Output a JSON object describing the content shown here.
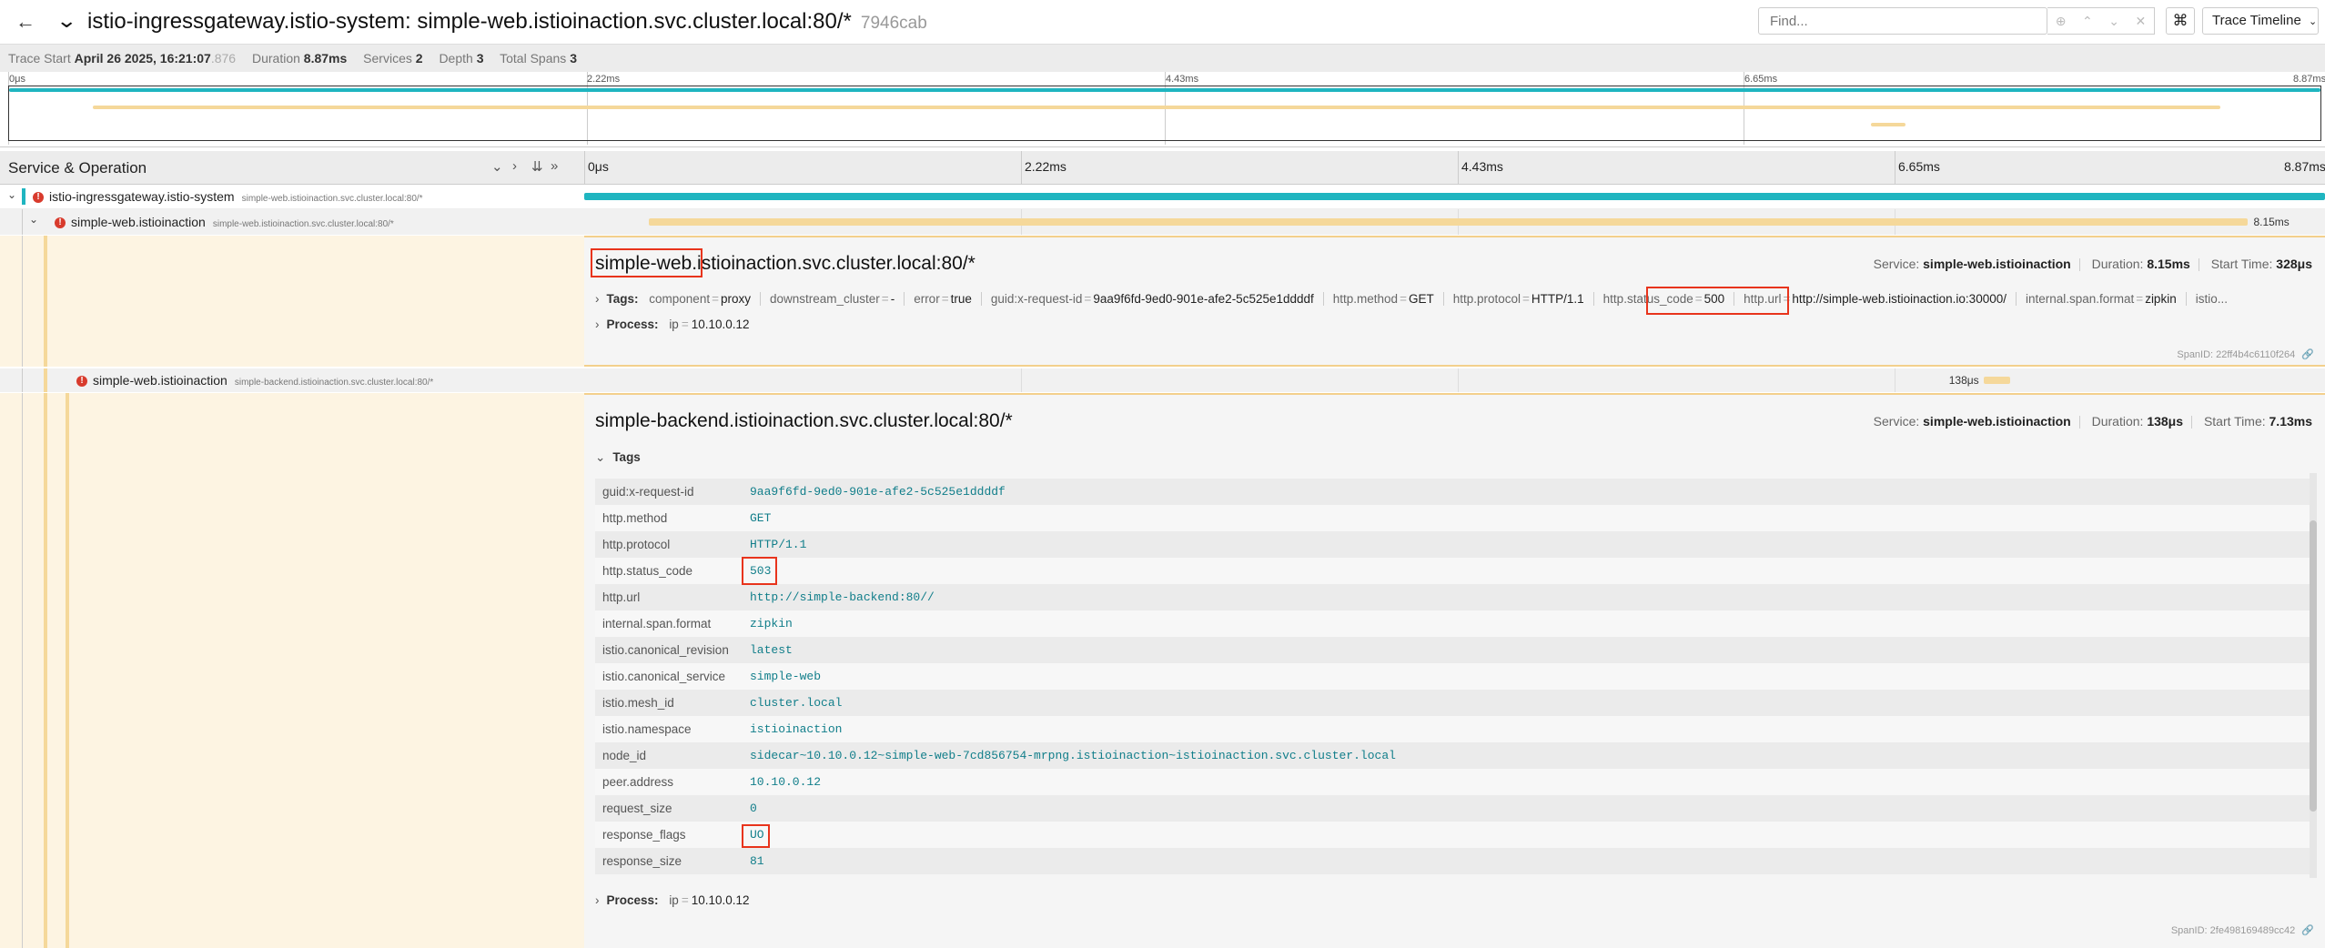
{
  "header": {
    "title": "istio-ingressgateway.istio-system: simple-web.istioinaction.svc.cluster.local:80/*",
    "trace_id": "7946cab",
    "find_placeholder": "Find...",
    "cmd_icon": "⌘",
    "view_select": "Trace Timeline"
  },
  "summary": {
    "trace_start_label": "Trace Start",
    "trace_start": "April 26 2025, 16:21:07",
    "trace_start_ms": ".876",
    "duration_label": "Duration",
    "duration": "8.87ms",
    "services_label": "Services",
    "services": "2",
    "depth_label": "Depth",
    "depth": "3",
    "total_spans_label": "Total Spans",
    "total_spans": "3"
  },
  "ticks": [
    "0μs",
    "2.22ms",
    "4.43ms",
    "6.65ms",
    "8.87ms"
  ],
  "table": {
    "service_operation_label": "Service & Operation"
  },
  "spans": [
    {
      "service": "istio-ingressgateway.istio-system",
      "operation": "simple-web.istioinaction.svc.cluster.local:80/*",
      "start_ms": 0,
      "duration_ms": 8.87,
      "color": "#1fb5c0"
    },
    {
      "service": "simple-web.istioinaction",
      "operation": "simple-web.istioinaction.svc.cluster.local:80/*",
      "start_ms": 0.328,
      "duration_ms": 8.15,
      "color": "#f5d89a",
      "bar_label": "8.15ms"
    },
    {
      "service": "simple-web.istioinaction",
      "operation": "simple-backend.istioinaction.svc.cluster.local:80/*",
      "start_ms": 7.13,
      "duration_ms": 0.138,
      "color": "#f5d89a",
      "bar_label": "138μs"
    }
  ],
  "detail1": {
    "title": "simple-web.istioinaction.svc.cluster.local:80/*",
    "service_label": "Service:",
    "service": "simple-web.istioinaction",
    "duration_label": "Duration:",
    "duration": "8.15ms",
    "start_label": "Start Time:",
    "start": "328μs",
    "tags_label": "Tags:",
    "tags": [
      {
        "k": "component",
        "v": "proxy"
      },
      {
        "k": "downstream_cluster",
        "v": "-"
      },
      {
        "k": "error",
        "v": "true"
      },
      {
        "k": "guid:x-request-id",
        "v": "9aa9f6fd-9ed0-901e-afe2-5c525e1ddddf"
      },
      {
        "k": "http.method",
        "v": "GET"
      },
      {
        "k": "http.protocol",
        "v": "HTTP/1.1"
      },
      {
        "k": "http.status_code",
        "v": "500"
      },
      {
        "k": "http.url",
        "v": "http://simple-web.istioinaction.io:30000/"
      },
      {
        "k": "internal.span.format",
        "v": "zipkin"
      },
      {
        "k": "istio.",
        "v": ""
      }
    ],
    "process_label": "Process:",
    "process_k": "ip",
    "process_v": "10.10.0.12",
    "span_id": "SpanID: 22ff4b4c6110f264"
  },
  "detail2": {
    "title": "simple-backend.istioinaction.svc.cluster.local:80/*",
    "service_label": "Service:",
    "service": "simple-web.istioinaction",
    "duration_label": "Duration:",
    "duration": "138μs",
    "start_label": "Start Time:",
    "start": "7.13ms",
    "tags_label": "Tags",
    "tags": [
      {
        "k": "guid:x-request-id",
        "v": "9aa9f6fd-9ed0-901e-afe2-5c525e1ddddf"
      },
      {
        "k": "http.method",
        "v": "GET"
      },
      {
        "k": "http.protocol",
        "v": "HTTP/1.1"
      },
      {
        "k": "http.status_code",
        "v": "503"
      },
      {
        "k": "http.url",
        "v": "http://simple-backend:80//"
      },
      {
        "k": "internal.span.format",
        "v": "zipkin"
      },
      {
        "k": "istio.canonical_revision",
        "v": "latest"
      },
      {
        "k": "istio.canonical_service",
        "v": "simple-web"
      },
      {
        "k": "istio.mesh_id",
        "v": "cluster.local"
      },
      {
        "k": "istio.namespace",
        "v": "istioinaction"
      },
      {
        "k": "node_id",
        "v": "sidecar~10.10.0.12~simple-web-7cd856754-mrpng.istioinaction~istioinaction.svc.cluster.local"
      },
      {
        "k": "peer.address",
        "v": "10.10.0.12"
      },
      {
        "k": "request_size",
        "v": "0"
      },
      {
        "k": "response_flags",
        "v": "UO"
      },
      {
        "k": "response_size",
        "v": "81"
      }
    ],
    "process_label": "Process:",
    "process_k": "ip",
    "process_v": "10.10.0.12",
    "span_id": "SpanID: 2fe498169489cc42"
  }
}
